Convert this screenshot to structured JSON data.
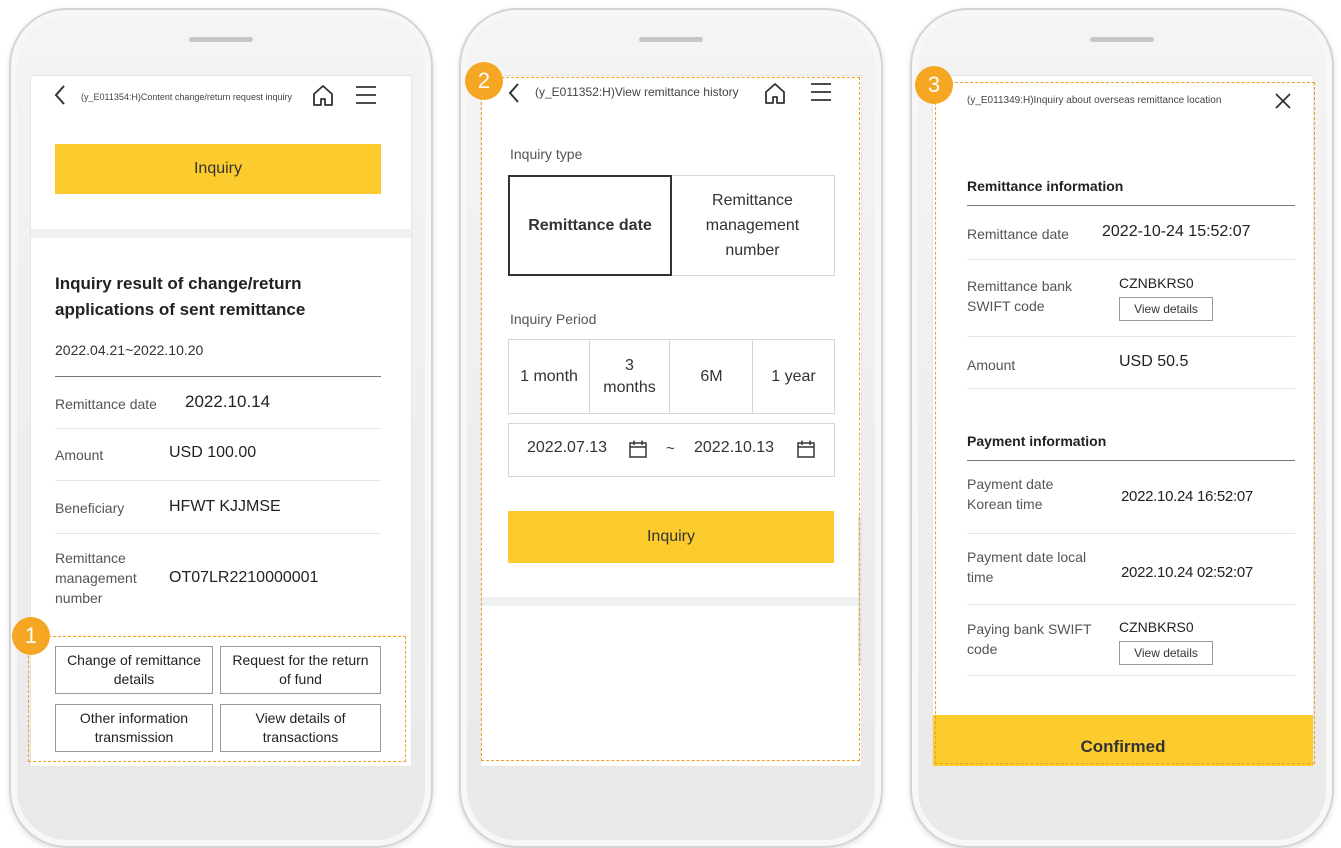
{
  "screen1": {
    "title": "(y_E011354:H)Content change/return request inquiry",
    "inquiry_button": "Inquiry",
    "result_heading": "Inquiry result of change/return applications of sent remittance",
    "period": "2022.04.21~2022.10.20",
    "rows": [
      {
        "label": "Remittance date",
        "value": "2022.10.14"
      },
      {
        "label": "Amount",
        "value": "USD 100.00"
      },
      {
        "label": "Beneficiary",
        "value": "HFWT KJJMSE"
      },
      {
        "label": "Remittance management number",
        "value": "OT07LR2210000001"
      }
    ],
    "actions": [
      "Change of remittance details",
      "Request for the return of fund",
      "Other information transmission",
      "View details of transactions"
    ],
    "badge": "1"
  },
  "screen2": {
    "title": "(y_E011352:H)View remittance history",
    "inquiry_type_label": "Inquiry type",
    "types": [
      "Remittance date",
      "Remittance management number"
    ],
    "selected_type": "Remittance date",
    "period_label": "Inquiry Period",
    "periods": [
      "1 month",
      "3 months",
      "6M",
      "1 year"
    ],
    "date_from": "2022.07.13",
    "separator": "~",
    "date_to": "2022.10.13",
    "inquiry_button": "Inquiry",
    "badge": "2"
  },
  "screen3": {
    "title": "(y_E011349:H)Inquiry about overseas remittance location",
    "remittance_section": "Remittance information",
    "remittance_rows": [
      {
        "label": "Remittance date",
        "value": "2022-10-24 15:52:07"
      },
      {
        "label": "Remittance bank SWIFT code",
        "value": "CZNBKRS0",
        "button": "View details"
      },
      {
        "label": "Amount",
        "value": "USD 50.5"
      }
    ],
    "payment_section": "Payment information",
    "payment_rows": [
      {
        "label": "Payment date Korean time",
        "value": "2022.10.24 16:52:07"
      },
      {
        "label": "Payment date local time",
        "value": "2022.10.24 02:52:07"
      },
      {
        "label": "Paying bank SWIFT code",
        "value": "CZNBKRS0",
        "button": "View details"
      }
    ],
    "confirm_button": "Confirmed",
    "badge": "3"
  },
  "colors": {
    "accent_yellow": "#fccc2e",
    "badge_orange": "#f5a623",
    "dash_orange": "#f0a020"
  }
}
